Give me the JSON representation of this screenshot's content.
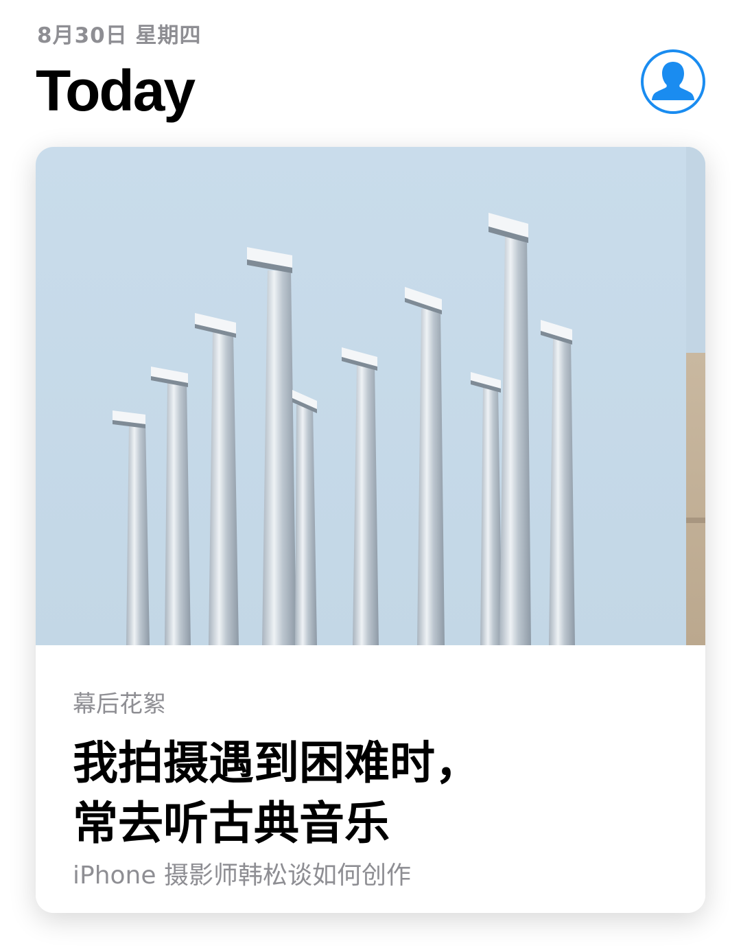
{
  "header": {
    "date": "8月30日 星期四",
    "title": "Today",
    "account_icon": "person-silhouette-icon"
  },
  "story_card": {
    "image_description_icon": "photo",
    "eyebrow": "幕后花絮",
    "headline_line1": "我拍摄遇到困难时，",
    "headline_line2": "常去听古典音乐",
    "subtitle": "iPhone 摄影师韩松谈如何创作"
  },
  "colors": {
    "accent": "#1a8cf0",
    "sky": "#c8dceb",
    "secondary_text": "#8e8e93"
  }
}
